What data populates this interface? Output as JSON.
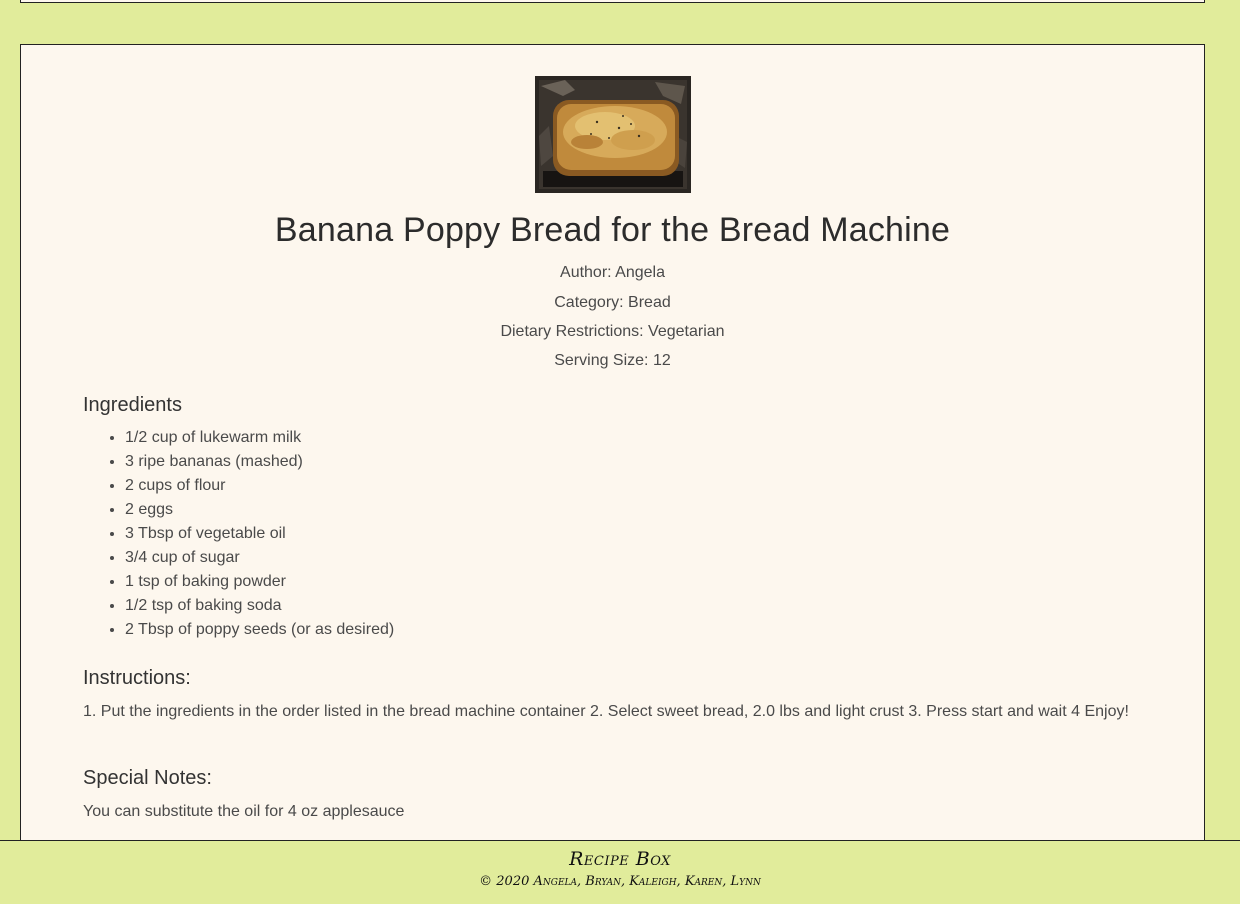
{
  "recipe": {
    "image_alt": "Banana poppy bread loaf in bread machine pan",
    "title": "Banana Poppy Bread for the Bread Machine",
    "author": "Author: Angela",
    "category": "Category: Bread",
    "dietary": "Dietary Restrictions: Vegetarian",
    "serving": "Serving Size: 12",
    "ingredients_heading": "Ingredients",
    "ingredients": [
      "1/2 cup of lukewarm milk",
      "3 ripe bananas (mashed)",
      "2 cups of flour",
      "2 eggs",
      "3 Tbsp of vegetable oil",
      "3/4 cup of sugar",
      "1 tsp of baking powder",
      "1/2 tsp of baking soda",
      "2 Tbsp of poppy seeds (or as desired)"
    ],
    "instructions_heading": "Instructions:",
    "instructions": "1. Put the ingredients in the order listed in the bread machine container 2. Select sweet bread, 2.0 lbs and light crust 3. Press start and wait 4 Enjoy!",
    "notes_heading": "Special Notes:",
    "notes": "You can substitute the oil for 4 oz applesauce"
  },
  "footer": {
    "title": "Recipe Box",
    "copyright": "© 2020 Angela, Bryan, Kaleigh, Karen, Lynn"
  },
  "colors": {
    "page_background": "#e1ec9b",
    "card_background": "#fdf7ee",
    "border": "#222222"
  }
}
